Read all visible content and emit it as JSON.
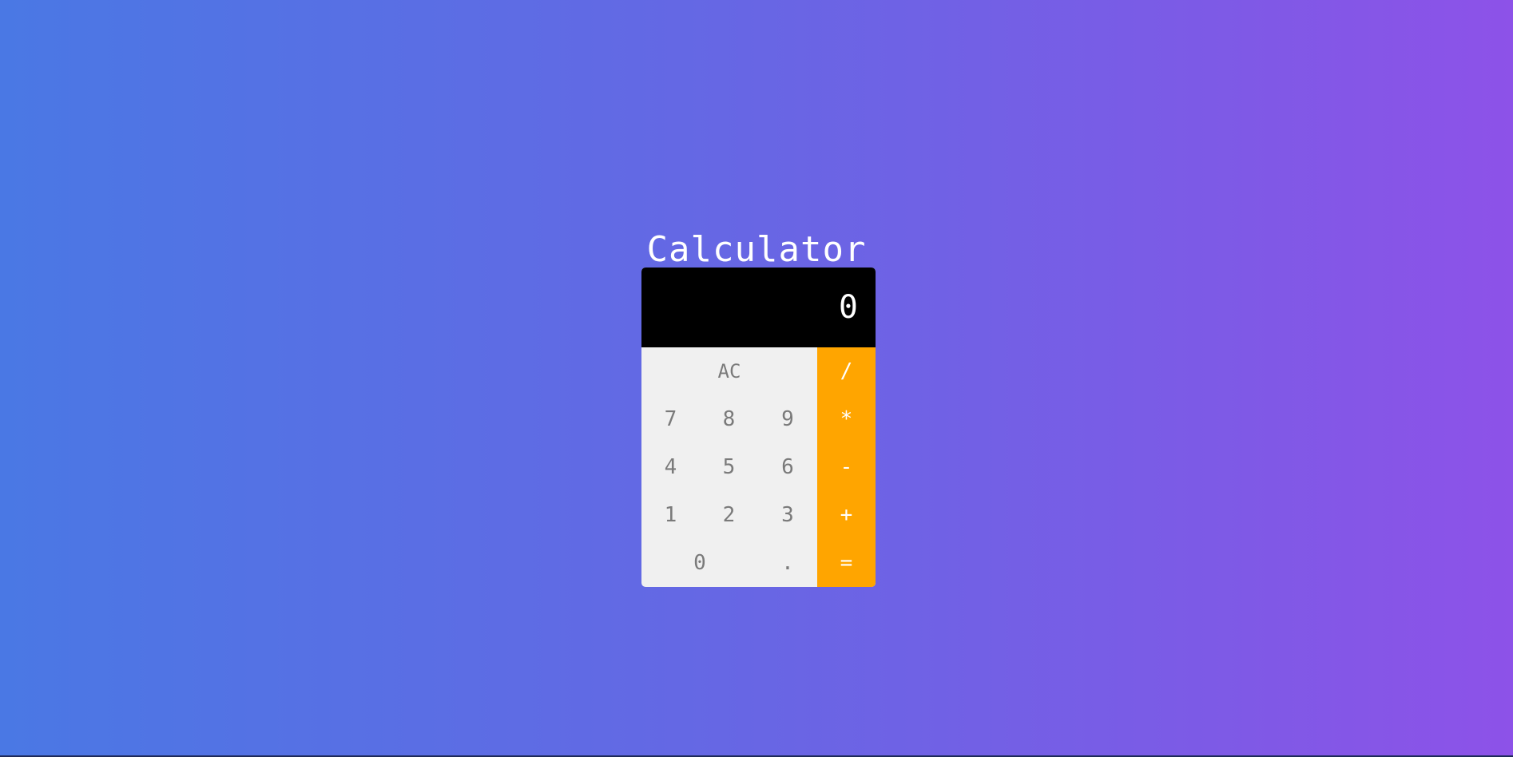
{
  "page": {
    "title": "Calculator"
  },
  "calculator": {
    "display_value": "0",
    "keys": {
      "clear": "AC",
      "divide": "/",
      "multiply": "*",
      "subtract": "-",
      "add": "+",
      "equals": "=",
      "seven": "7",
      "eight": "8",
      "nine": "9",
      "four": "4",
      "five": "5",
      "six": "6",
      "one": "1",
      "two": "2",
      "three": "3",
      "zero": "0",
      "decimal": "."
    }
  },
  "colors": {
    "background_start": "#4a78e4",
    "background_end": "#8d52e8",
    "display_background": "#000000",
    "keypad_background": "#f0f0f0",
    "operator_background": "#ffa500",
    "number_text": "#7a7a7a",
    "operator_text": "#ffffff"
  }
}
